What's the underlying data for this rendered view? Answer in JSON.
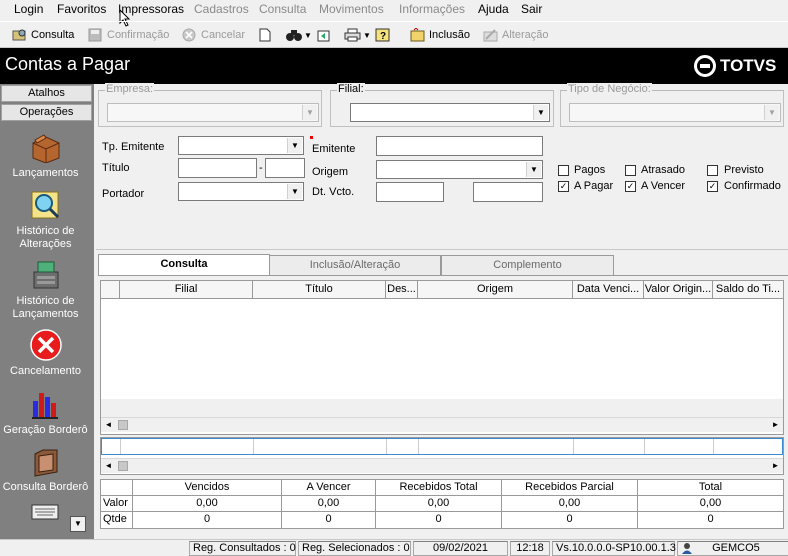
{
  "menu": [
    {
      "label": "Login",
      "enabled": true
    },
    {
      "label": "Favoritos",
      "enabled": true
    },
    {
      "label": "Impressoras",
      "enabled": true
    },
    {
      "label": "Cadastros",
      "enabled": false
    },
    {
      "label": "Consulta",
      "enabled": false
    },
    {
      "label": "Movimentos",
      "enabled": false
    },
    {
      "label": "Informações",
      "enabled": false
    },
    {
      "label": "Ajuda",
      "enabled": true
    },
    {
      "label": "Sair",
      "enabled": true
    }
  ],
  "toolbar": {
    "consulta": "Consulta",
    "confirmacao": "Confirmação",
    "cancelar": "Cancelar",
    "inclusao": "Inclusão",
    "alteracao": "Alteração"
  },
  "app": {
    "title": "Contas a Pagar",
    "brand": "TOTVS"
  },
  "sidebar": {
    "tab_atalhos": "Atalhos",
    "tab_operacoes": "Operações",
    "items": [
      {
        "label": "Lançamentos",
        "icon": "box-icon"
      },
      {
        "label": "Histórico de Alterações",
        "icon": "magnifier-icon"
      },
      {
        "label": "Histórico de Lançamentos",
        "icon": "register-icon"
      },
      {
        "label": "Cancelamento",
        "icon": "cancel-icon"
      },
      {
        "label": "Geração Borderô",
        "icon": "chart-bars-icon"
      },
      {
        "label": "Consulta Borderô",
        "icon": "folder-icon"
      }
    ]
  },
  "filters": {
    "empresa_label": "Empresa:",
    "filial_label": "Filial:",
    "tipo_negocio_label": "Tipo de Negócio:",
    "tp_emitente_label": "Tp. Emitente",
    "emitente_label": "Emitente",
    "titulo_label": "Título",
    "titulo_sep": "-",
    "origem_label": "Origem",
    "portador_label": "Portador",
    "dt_vcto_label": "Dt. Vcto.",
    "dt_vcto_from": "",
    "dt_vcto_to": ""
  },
  "checkboxes": [
    {
      "label": "Pagos",
      "checked": false
    },
    {
      "label": "Atrasado",
      "checked": false
    },
    {
      "label": "Previsto",
      "checked": false
    },
    {
      "label": "A Pagar",
      "checked": true
    },
    {
      "label": "A Vencer",
      "checked": true
    },
    {
      "label": "Confirmado",
      "checked": true
    }
  ],
  "tabs": [
    "Consulta",
    "Inclusão/Alteração",
    "Complemento"
  ],
  "grid": {
    "columns": [
      "",
      "Filial",
      "Título",
      "Des...",
      "Origem",
      "Data Venci...",
      "Valor Origin...",
      "Saldo do Ti..."
    ]
  },
  "totals": {
    "headers": [
      "",
      "Vencidos",
      "A Vencer",
      "Recebidos Total",
      "Recebidos Parcial",
      "Total"
    ],
    "rows": [
      [
        "Valor",
        "0,00",
        "0,00",
        "0,00",
        "0,00",
        "0,00"
      ],
      [
        "Qtde",
        "0",
        "0",
        "0",
        "0",
        "0"
      ]
    ]
  },
  "status": {
    "reg_consultados": "Reg. Consultados : 0",
    "reg_selecionados": "Reg. Selecionados : 0",
    "date": "09/02/2021",
    "time": "12:18",
    "version": "Vs.10.0.0.0-SP10.00.1.3",
    "user": "GEMCO5"
  },
  "colors": {
    "title_bg": "#000000",
    "sidebar_bg": "#808080",
    "cancel_red": "#e81c1c"
  }
}
